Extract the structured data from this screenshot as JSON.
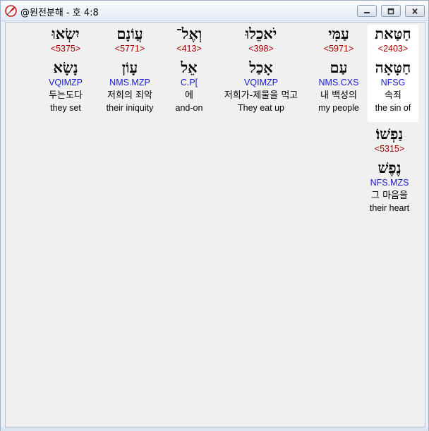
{
  "window": {
    "title": "@원전분해 - 호 4:8",
    "app_icon": "compass-icon",
    "buttons": [
      "minimize-icon",
      "maximize-icon",
      "close-icon"
    ]
  },
  "words": [
    {
      "hebrew": "חַטַּאת",
      "strong": "<2403>",
      "lemma": "חַטָּאָה",
      "parse": "NFSG",
      "korean": "속죄",
      "english": "the sin of",
      "selected": true
    },
    {
      "hebrew": "עַמִּי",
      "strong": "<5971>",
      "lemma": "עַם",
      "parse": "NMS.CXS",
      "korean": "내 백성의",
      "english": "my people",
      "selected": false
    },
    {
      "hebrew": "יֹאכֵלוּ",
      "strong": "<398>",
      "lemma": "אָכַל",
      "parse": "VQIMZP",
      "korean": "저희가-제물을 먹고",
      "english": "They eat up",
      "selected": false
    },
    {
      "hebrew": "וְאֶל־",
      "strong": "<413>",
      "lemma": "אֵל",
      "parse": "C.P[",
      "korean": "에",
      "english": "and-on",
      "selected": false
    },
    {
      "hebrew": "עֲוֹנָם",
      "strong": "<5771>",
      "lemma": "עָוֹן",
      "parse": "NMS.MZP",
      "korean": "저희의 죄악",
      "english": "their iniquity",
      "selected": false
    },
    {
      "hebrew": "יִשְׂאוּ",
      "strong": "<5375>",
      "lemma": "נָשָׂא",
      "parse": "VQIMZP",
      "korean": "두는도다",
      "english": "they set",
      "selected": false
    },
    {
      "hebrew": "נַפְשׁוֹ׃",
      "strong": "<5315>",
      "lemma": "נֶפֶשׁ",
      "parse": "NFS.MZS",
      "korean": "그 마음을",
      "english": "their heart",
      "selected": false
    }
  ],
  "colors": {
    "strong": "#a00000",
    "parse": "#1a1ad0",
    "background": "#f0f0f0",
    "selected": "#ffffff"
  }
}
